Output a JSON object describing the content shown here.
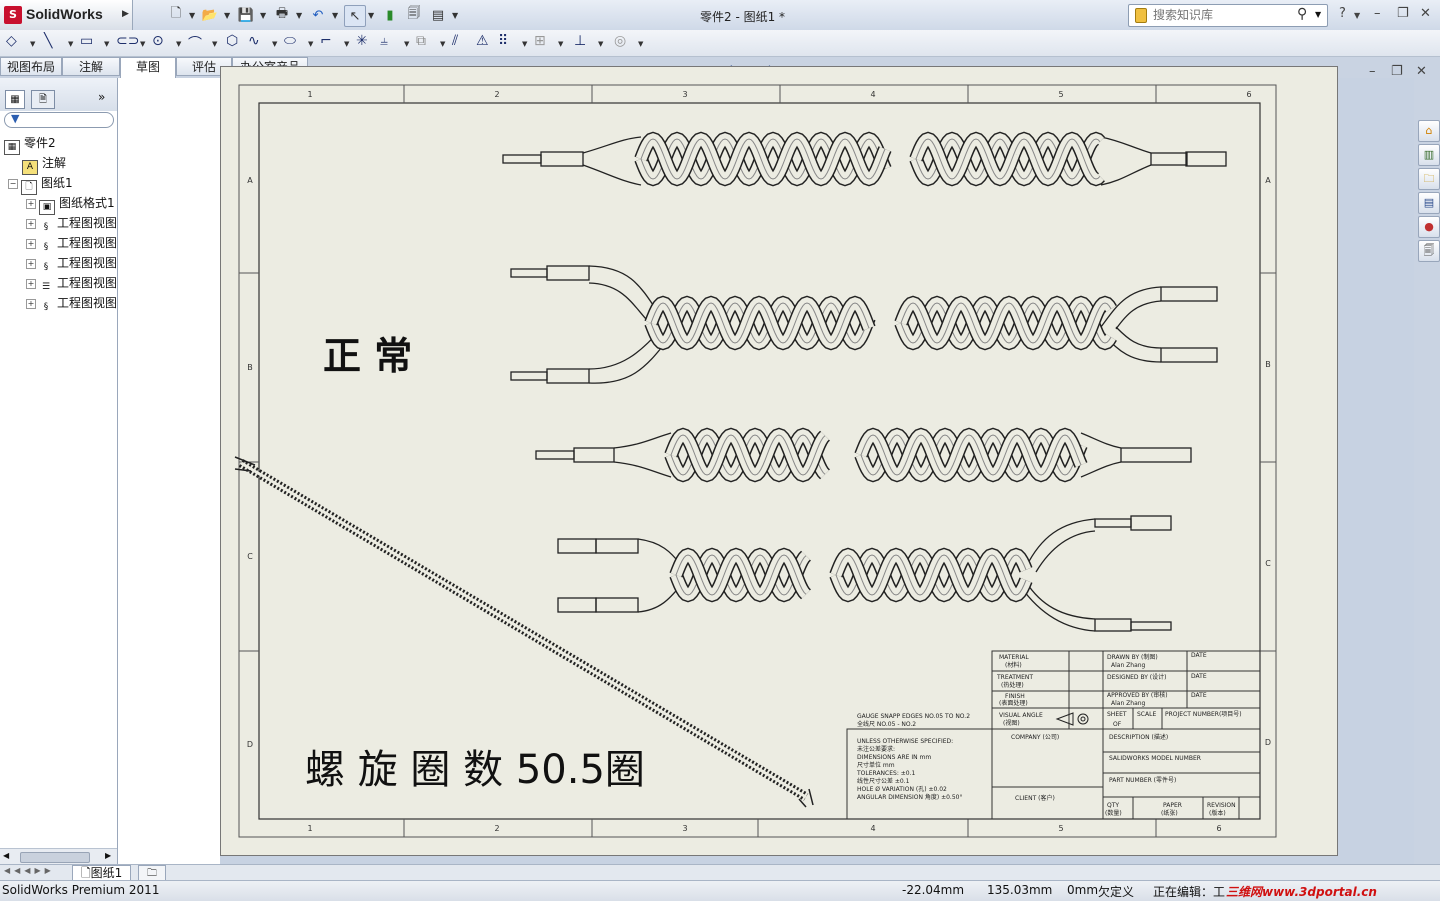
{
  "app": {
    "brand": "SolidWorks",
    "document_title": "零件2 - 图纸1 *"
  },
  "search": {
    "placeholder": "搜索知识库"
  },
  "tabs": [
    {
      "label": "视图布局"
    },
    {
      "label": "注解"
    },
    {
      "label": "草图"
    },
    {
      "label": "评估"
    },
    {
      "label": "办公室产品"
    }
  ],
  "active_tab": "草图",
  "tree": {
    "root": "零件2",
    "annotations": "注解",
    "sheet": "图纸1",
    "children": [
      "图纸格式1",
      "工程图视图",
      "工程图视图",
      "工程图视图",
      "工程图视图",
      "工程图视图"
    ]
  },
  "drawing": {
    "zone_numbers": [
      "1",
      "2",
      "3",
      "4",
      "5",
      "6"
    ],
    "zone_letters": [
      "A",
      "B",
      "C",
      "D"
    ],
    "label_normal": "正 常",
    "label_turns": "螺 旋 圈 数 50.5圈",
    "title_block": {
      "material": "MATERIAL",
      "material_cn": "(材料)",
      "treatment": "TREATMENT",
      "treatment_cn": "(热处理)",
      "finish": "FINISH",
      "finish_cn": "(表面处理)",
      "visual_angle": "VISUAL ANGLE",
      "visual_angle_cn": "(视图)",
      "drawn_by": "DRAWN BY (制图)",
      "drawn_name": "Alan Zhang",
      "designed_by": "DESIGNED BY (设计)",
      "approved_by": "APPROVED BY (审核)",
      "approved_name": "Alan Zhang",
      "date": "DATE",
      "sheet": "SHEET",
      "sheet_of": "OF",
      "scale": "SCALE",
      "project_number": "PROJECT NUMBER(项目号)",
      "company": "COMPANY (公司)",
      "description": "DESCRIPTION (描述)",
      "model_number": "SALIDWORKS MODEL NUMBER",
      "part_number": "PART NUMBER (零件号)",
      "client": "CLIENT (客户)",
      "qty": "QTY",
      "qty_cn": "(数量)",
      "paper": "PAPER",
      "paper_cn": "(纸张)",
      "revision": "REVISION",
      "revision_cn": "(版本)",
      "gauge_1": "GAUGE SNAPP EDGES NO.05 TO NO.2",
      "gauge_2": "全线尺 NO.05 - NO.2",
      "notes": [
        "UNLESS OTHERWISE SPECIFIED:",
        "未注公差要求:",
        "DIMENSIONS ARE IN mm",
        "尺寸单位 mm",
        "TOLERANCES: ±0.1",
        "线性尺寸公差 ±0.1",
        "HOLE Ø VARIATION (孔) ±0.02",
        "ANGULAR DIMENSION 角度) ±0.50°"
      ]
    }
  },
  "sheet_tab": "图纸1",
  "status": {
    "product": "SolidWorks Premium 2011",
    "x": "-22.04mm",
    "y": "135.03mm",
    "z": "0mm",
    "state": "欠定义",
    "editing": "正在编辑：工",
    "watermark": "三维网www.3dportal.cn"
  },
  "colors": {
    "sheet_bg": "#ecece2",
    "viewport_bg": "#c7d2e2",
    "brand_red": "#c8102e"
  }
}
